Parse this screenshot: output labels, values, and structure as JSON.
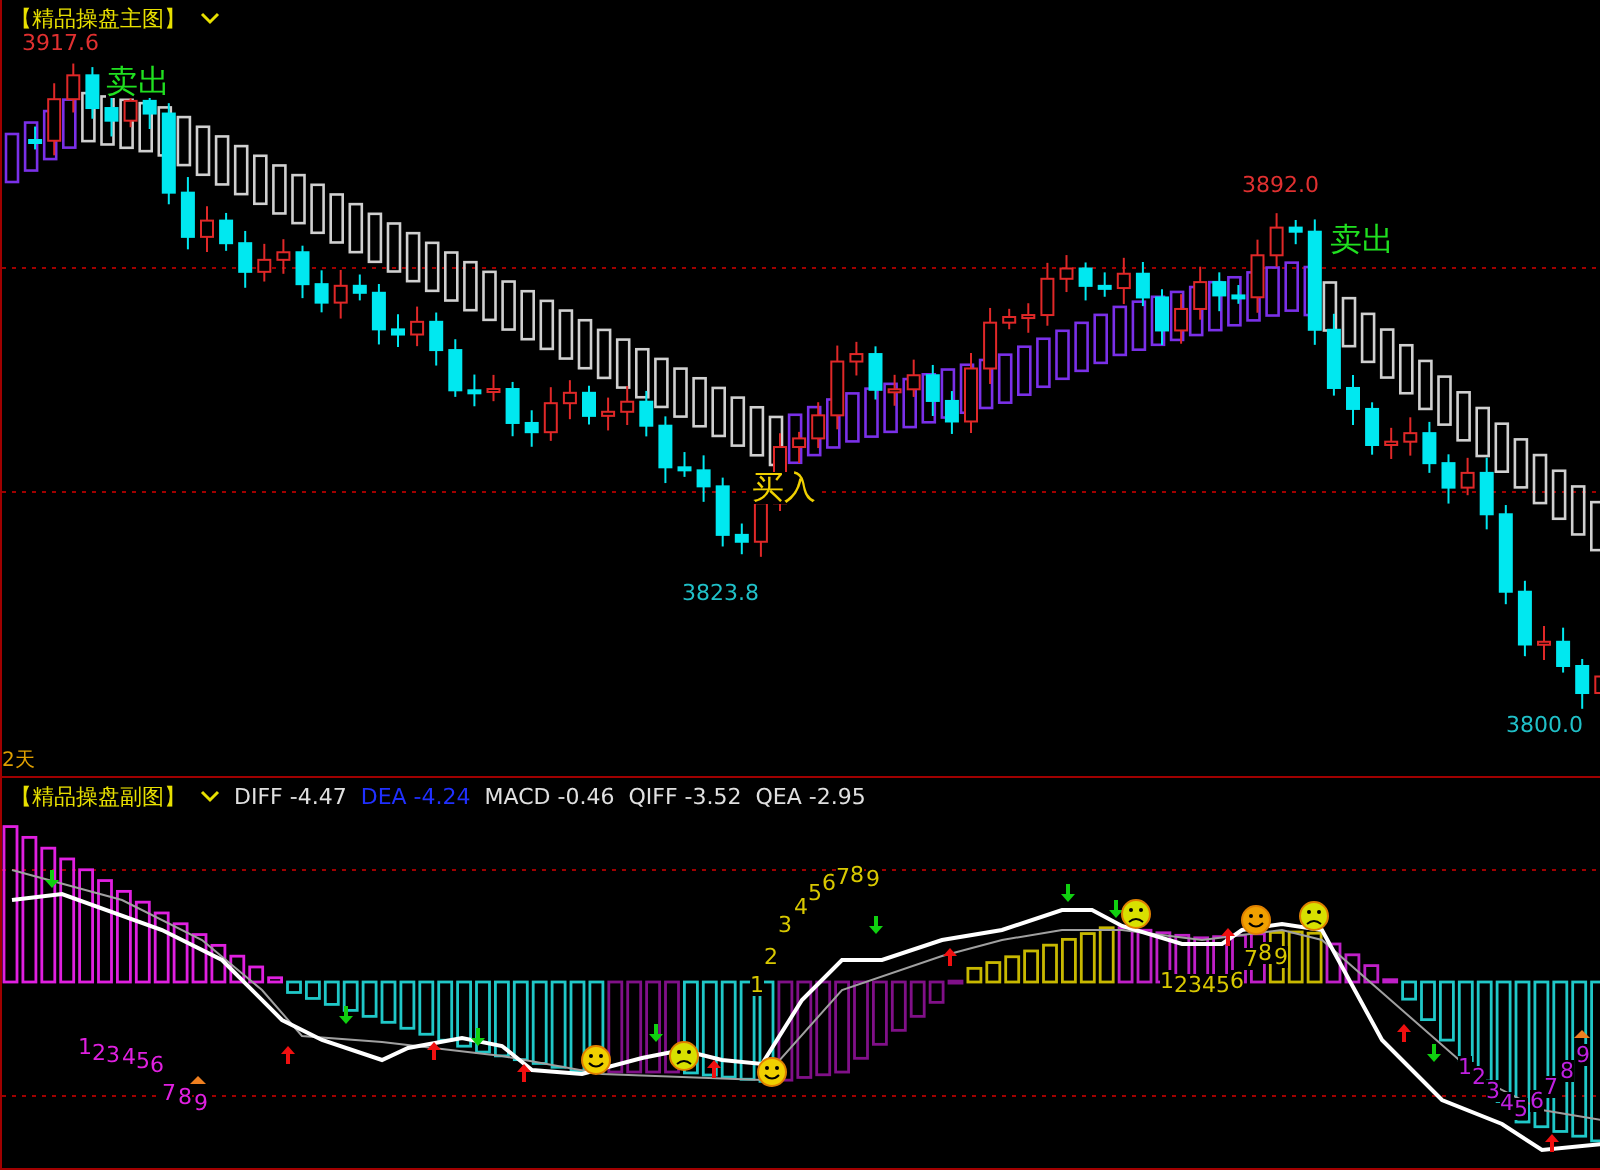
{
  "main_chart": {
    "title": "【精品操盘主图】",
    "labels": [
      {
        "kind": "high",
        "text": "3917.6"
      },
      {
        "kind": "sell",
        "text": "卖出"
      },
      {
        "kind": "buy",
        "text": "买入"
      },
      {
        "kind": "low",
        "text": "3823.8"
      },
      {
        "kind": "high",
        "text": "3892.0"
      },
      {
        "kind": "sell",
        "text": "卖出"
      },
      {
        "kind": "low",
        "text": "3800.0"
      }
    ],
    "period": "2天"
  },
  "sub_chart": {
    "title": "【精品操盘副图】",
    "indicators": [
      {
        "name": "DIFF",
        "value": "-4.47",
        "color": "#e0e0e0"
      },
      {
        "name": "DEA",
        "value": "-4.24",
        "color": "#2030ff"
      },
      {
        "name": "MACD",
        "value": "-0.46",
        "color": "#e0e0e0"
      },
      {
        "name": "QIFF",
        "value": "-3.52",
        "color": "#e0e0e0"
      },
      {
        "name": "QEA",
        "value": "-2.95",
        "color": "#e0e0e0"
      }
    ],
    "sequences": [
      {
        "color": "#e020e0",
        "digits": [
          "1",
          "2",
          "3",
          "4",
          "5",
          "6",
          "7",
          "8",
          "9"
        ]
      },
      {
        "color": "#d8c800",
        "digits": [
          "1",
          "2",
          "3",
          "4",
          "5",
          "6",
          "7",
          "8",
          "9"
        ]
      },
      {
        "color": "#d8c800",
        "digits": [
          "1",
          "2",
          "3",
          "4",
          "5",
          "6",
          "7",
          "8",
          "9"
        ]
      },
      {
        "color": "#c020e0",
        "digits": [
          "1",
          "2",
          "3",
          "4",
          "5",
          "6",
          "7",
          "8",
          "9"
        ]
      }
    ]
  }
}
